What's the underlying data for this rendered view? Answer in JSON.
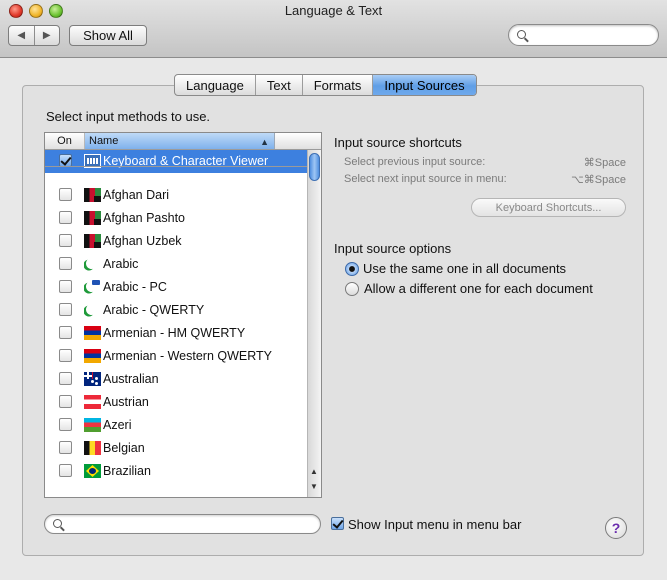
{
  "window": {
    "title": "Language & Text",
    "show_all": "Show All",
    "back_glyph": "◀",
    "forward_glyph": "▶",
    "search_placeholder": ""
  },
  "tabs": [
    {
      "label": "Language",
      "active": false
    },
    {
      "label": "Text",
      "active": false
    },
    {
      "label": "Formats",
      "active": false
    },
    {
      "label": "Input Sources",
      "active": true
    }
  ],
  "input_methods": {
    "heading": "Select input methods to use.",
    "col_on": "On",
    "col_name": "Name",
    "sort_glyph": "▲",
    "rows": [
      {
        "name": "Keyboard & Character Viewer",
        "checked": true,
        "selected": true,
        "icon": "keyboard-viewer-icon"
      },
      {
        "name": "Afghan Dari",
        "checked": false,
        "icon": "afghanistan-flag-icon"
      },
      {
        "name": "Afghan Pashto",
        "checked": false,
        "icon": "afghanistan-flag-icon"
      },
      {
        "name": "Afghan Uzbek",
        "checked": false,
        "icon": "afghanistan-flag-icon"
      },
      {
        "name": "Arabic",
        "checked": false,
        "icon": "arabic-crescent-icon"
      },
      {
        "name": "Arabic - PC",
        "checked": false,
        "icon": "arabic-pc-icon"
      },
      {
        "name": "Arabic - QWERTY",
        "checked": false,
        "icon": "arabic-crescent-icon"
      },
      {
        "name": "Armenian - HM QWERTY",
        "checked": false,
        "icon": "armenia-flag-icon"
      },
      {
        "name": "Armenian - Western QWERTY",
        "checked": false,
        "icon": "armenia-flag-icon"
      },
      {
        "name": "Australian",
        "checked": false,
        "icon": "australia-flag-icon"
      },
      {
        "name": "Austrian",
        "checked": false,
        "icon": "austria-flag-icon"
      },
      {
        "name": "Azeri",
        "checked": false,
        "icon": "azerbaijan-flag-icon"
      },
      {
        "name": "Belgian",
        "checked": false,
        "icon": "belgium-flag-icon"
      },
      {
        "name": "Brazilian",
        "checked": false,
        "icon": "brazil-flag-icon"
      }
    ],
    "filter_placeholder": ""
  },
  "show_menu": {
    "label": "Show Input menu in menu bar",
    "checked": true
  },
  "help_label": "?",
  "shortcuts": {
    "heading": "Input source shortcuts",
    "items": [
      {
        "label": "Select previous input source:",
        "key": "⌘Space"
      },
      {
        "label": "Select next input source in menu:",
        "key": "⌥⌘Space"
      }
    ],
    "button": "Keyboard Shortcuts..."
  },
  "options": {
    "heading": "Input source options",
    "radios": [
      {
        "label": "Use the same one in all documents",
        "selected": true
      },
      {
        "label": "Allow a different one for each document",
        "selected": false
      }
    ]
  },
  "colors": {
    "selection": "#3d80df",
    "tab_active": "#5f9ee6"
  }
}
